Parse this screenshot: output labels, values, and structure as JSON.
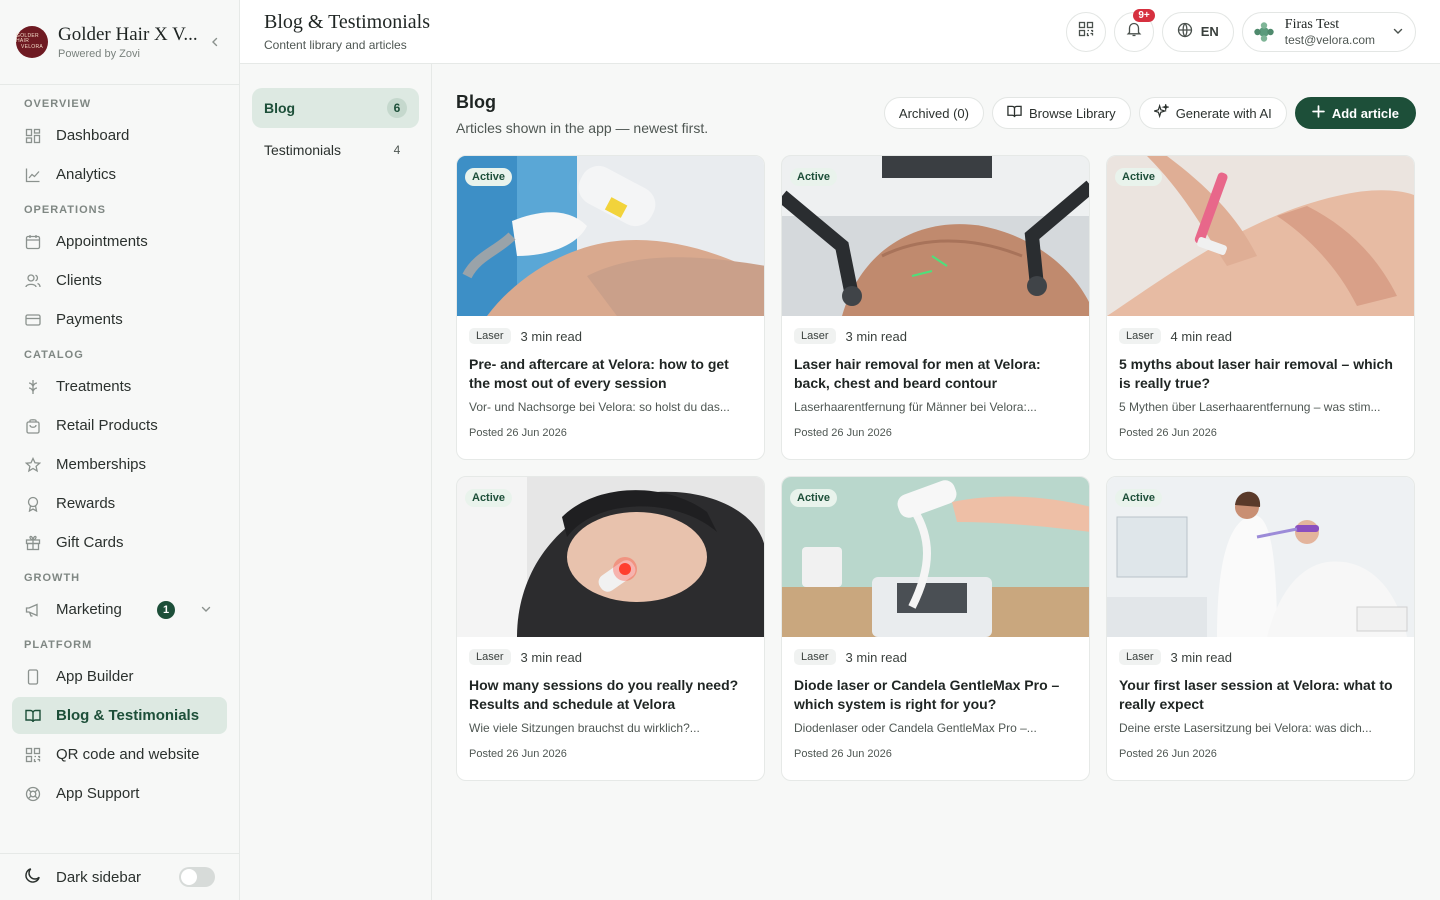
{
  "brand": {
    "logo_line1": "GOLDER HAIR",
    "logo_line2": "VELORA",
    "name": "Golder Hair X V...",
    "sub": "Powered by Zovi"
  },
  "sidebar": {
    "sections": {
      "overview": "OVERVIEW",
      "operations": "OPERATIONS",
      "catalog": "CATALOG",
      "growth": "GROWTH",
      "platform": "PLATFORM"
    },
    "items": {
      "dashboard": "Dashboard",
      "analytics": "Analytics",
      "appointments": "Appointments",
      "clients": "Clients",
      "payments": "Payments",
      "treatments": "Treatments",
      "retail": "Retail Products",
      "memberships": "Memberships",
      "rewards": "Rewards",
      "giftcards": "Gift Cards",
      "marketing": "Marketing",
      "marketing_badge": "1",
      "appbuilder": "App Builder",
      "blog": "Blog & Testimonials",
      "qr": "QR code and website",
      "support": "App Support"
    },
    "footer_label": "Dark sidebar"
  },
  "header": {
    "title": "Blog & Testimonials",
    "subtitle": "Content library and articles",
    "notif_count": "9+",
    "lang": "EN",
    "user_name": "Firas Test",
    "user_email": "test@velora.com"
  },
  "subnav": [
    {
      "label": "Blog",
      "count": "6"
    },
    {
      "label": "Testimonials",
      "count": "4"
    }
  ],
  "main": {
    "title": "Blog",
    "subtitle": "Articles shown in the app — newest first.",
    "archived_label": "Archived (0)",
    "browse_label": "Browse Library",
    "generate_label": "Generate with AI",
    "add_label": "Add article"
  },
  "cards": [
    {
      "status": "Active",
      "tag": "Laser",
      "read": "3 min read",
      "title": "Pre- and aftercare at Velora: how to get the most out of every session",
      "excerpt": "Vor- und Nachsorge bei Velora: so holst du das...",
      "date": "Posted 26 Jun 2026"
    },
    {
      "status": "Active",
      "tag": "Laser",
      "read": "3 min read",
      "title": "Laser hair removal for men at Velora: back, chest and beard contour",
      "excerpt": "Laserhaarentfernung für Männer bei Velora:...",
      "date": "Posted 26 Jun 2026"
    },
    {
      "status": "Active",
      "tag": "Laser",
      "read": "4 min read",
      "title": "5 myths about laser hair removal – which is really true?",
      "excerpt": "5 Mythen über Laserhaarentfernung – was stim...",
      "date": "Posted 26 Jun 2026"
    },
    {
      "status": "Active",
      "tag": "Laser",
      "read": "3 min read",
      "title": "How many sessions do you really need? Results and schedule at Velora",
      "excerpt": "Wie viele Sitzungen brauchst du wirklich?...",
      "date": "Posted 26 Jun 2026"
    },
    {
      "status": "Active",
      "tag": "Laser",
      "read": "3 min read",
      "title": "Diode laser or Candela GentleMax Pro – which system is right for you?",
      "excerpt": "Diodenlaser oder Candela GentleMax Pro –...",
      "date": "Posted 26 Jun 2026"
    },
    {
      "status": "Active",
      "tag": "Laser",
      "read": "3 min read",
      "title": "Your first laser session at Velora: what to really expect",
      "excerpt": "Deine erste Lasersitzung bei Velora: was dich...",
      "date": "Posted 26 Jun 2026"
    }
  ],
  "colors": {
    "accent": "#1d4f39",
    "accent_soft": "#dde9e2",
    "notif_badge": "#d6303f",
    "brand_logo": "#6e1a22"
  }
}
